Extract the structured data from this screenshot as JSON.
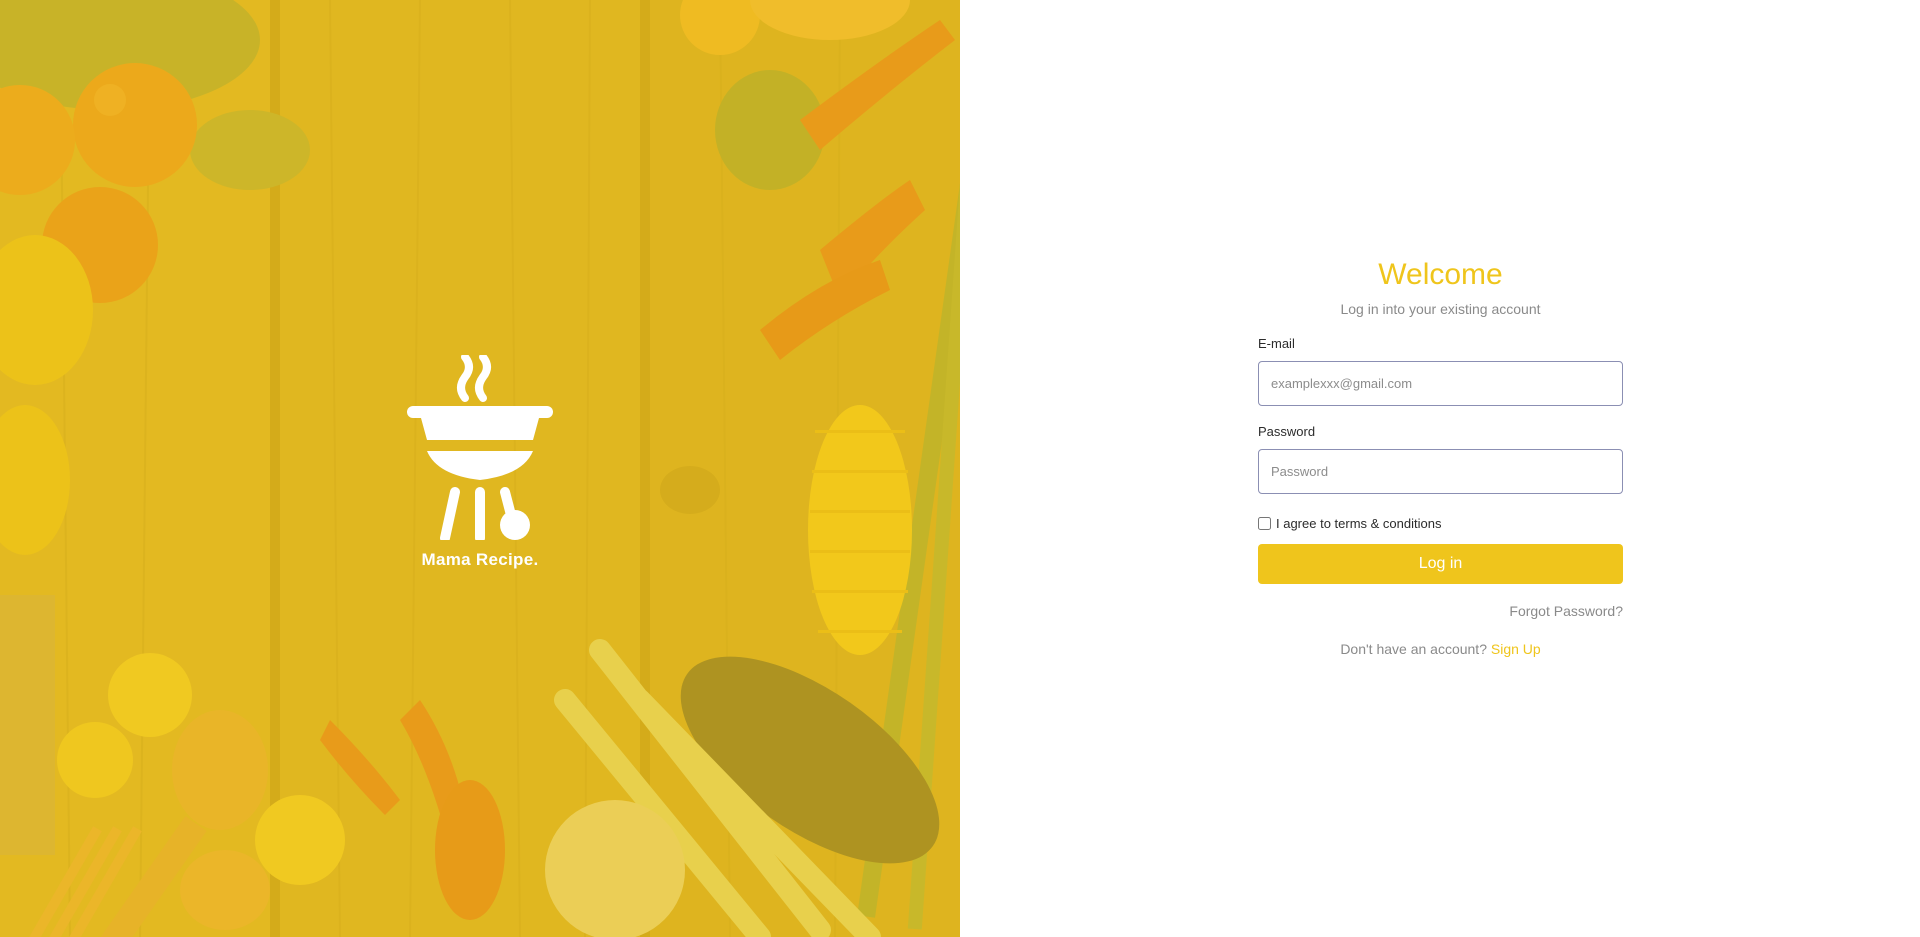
{
  "brand": {
    "name": "Mama Recipe.",
    "logo_icon": "grill-icon",
    "background": "food-ingredients-on-wooden-table",
    "overlay_color": "#EEC31A"
  },
  "login": {
    "title": "Welcome",
    "subtitle": "Log in into your existing account",
    "email": {
      "label": "E-mail",
      "value": "",
      "placeholder": "examplexxx@gmail.com"
    },
    "password": {
      "label": "Password",
      "value": "",
      "placeholder": "Password"
    },
    "terms": {
      "label": "I agree to terms & conditions",
      "checked": false
    },
    "submit_label": "Log in",
    "forgot_label": "Forgot Password?",
    "signup_prompt": "Don't have an account?",
    "signup_label": "Sign Up"
  },
  "colors": {
    "accent": "#EFC51C",
    "muted_text": "#8A8A8A",
    "input_border": "#8B8FB3"
  }
}
